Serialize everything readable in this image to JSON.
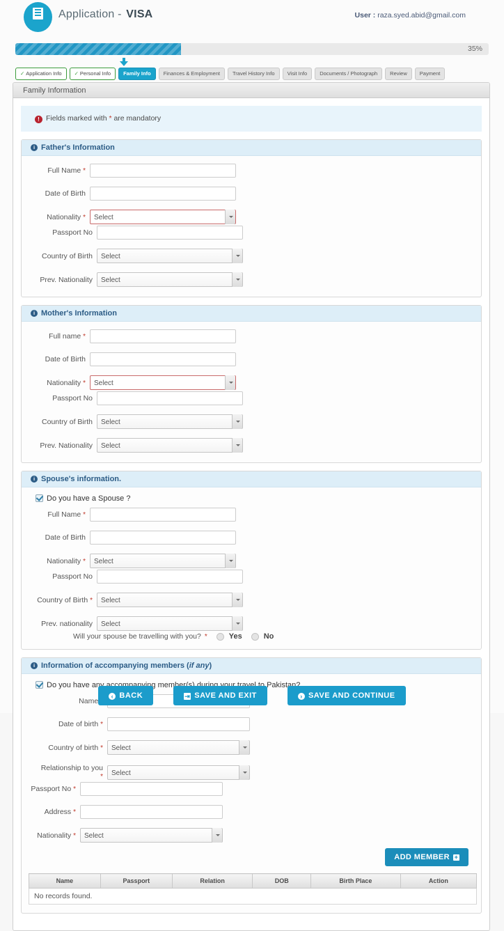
{
  "header": {
    "logo_icon": "document-list-icon",
    "app_title": "Application - ",
    "app_title_bold": "VISA",
    "user_label": "User : ",
    "user_email": "raza.syed.abid@gmail.com"
  },
  "progress": {
    "percent_label": "35%",
    "percent_value": 35,
    "fill_color": "#2196c4",
    "track_color": "#e9e9e9"
  },
  "tabs": [
    {
      "label": "Application Info",
      "state": "done",
      "check": "✓"
    },
    {
      "label": "Personal Info",
      "state": "done",
      "check": "✓"
    },
    {
      "label": "Family Info",
      "state": "active"
    },
    {
      "label": "Finances & Employment",
      "state": "pending"
    },
    {
      "label": "Travel History Info",
      "state": "pending"
    },
    {
      "label": "Visit Info",
      "state": "pending"
    },
    {
      "label": "Documents / Photograph",
      "state": "pending"
    },
    {
      "label": "Review",
      "state": "pending"
    },
    {
      "label": "Payment",
      "state": "pending"
    }
  ],
  "panel": {
    "title": "Family Information"
  },
  "notice": {
    "icon": "exclamation-icon",
    "text_before": "Fields marked with ",
    "star": "*",
    "text_after": " are mandatory"
  },
  "father": {
    "heading": "Father's Information",
    "full_name_label": "Full Name",
    "full_name_value": "",
    "dob_label": "Date of Birth",
    "dob_value": "",
    "nationality_label": "Nationality",
    "nationality_value": "Select",
    "passport_label": "Passport No",
    "passport_value": "",
    "country_label": "Country of Birth",
    "country_value": "Select",
    "prev_nat_label": "Prev. Nationality",
    "prev_nat_value": "Select"
  },
  "mother": {
    "heading": "Mother's Information",
    "full_name_label": "Full name",
    "full_name_value": "",
    "dob_label": "Date of Birth",
    "dob_value": "",
    "nationality_label": "Nationality",
    "nationality_value": "Select",
    "passport_label": "Passport No",
    "passport_value": "",
    "country_label": "Country of Birth",
    "country_value": "Select",
    "prev_nat_label": "Prev. Nationality",
    "prev_nat_value": "Select"
  },
  "spouse": {
    "heading": "Spouse's information.",
    "checkbox_label": "Do you have a Spouse ?",
    "checkbox_checked": true,
    "full_name_label": "Full Name",
    "full_name_value": "",
    "dob_label": "Date of Birth",
    "dob_value": "",
    "nationality_label": "Nationality",
    "nationality_value": "Select",
    "passport_label": "Passport No",
    "passport_value": "",
    "country_label": "Country of Birth",
    "country_value": "Select",
    "prev_nat_label": "Prev. nationality",
    "prev_nat_value": "Select",
    "travel_question": "Will your spouse be travelling with you?",
    "yes_label": "Yes",
    "no_label": "No",
    "selected": ""
  },
  "accompanying": {
    "heading_before": "Information of accompanying members (",
    "heading_italic": "if any",
    "heading_after": ")",
    "checkbox_label": "Do you have any accompanying member(s) during your travel to Pakistan?",
    "checkbox_checked": true,
    "name_label": "Name",
    "name_value": "",
    "dob_label": "Date of birth",
    "dob_value": "",
    "country_label": "Country of birth",
    "country_value": "Select",
    "relationship_label": "Relationship to you",
    "relationship_value": "Select",
    "passport_label": "Passport No",
    "passport_value": "",
    "address_label": "Address",
    "address_value": "",
    "nationality_label": "Nationality",
    "nationality_value": "Select",
    "add_member_label": "ADD MEMBER",
    "add_icon": "plus-icon",
    "table": {
      "columns": [
        "Name",
        "Passport",
        "Relation",
        "DOB",
        "Birth Place",
        "Action"
      ],
      "rows": [],
      "empty_message": "No records found."
    }
  },
  "footer": {
    "back_label": "BACK",
    "back_icon": "circle-left-icon",
    "save_exit_label": "SAVE AND EXIT",
    "save_exit_icon": "exit-icon",
    "save_continue_label": "SAVE AND CONTINUE",
    "save_continue_icon": "circle-right-icon"
  },
  "colors": {
    "accent": "#1ba4cc",
    "section_header_bg": "#ddeef8",
    "section_header_text": "#2c5c86",
    "required_star": "#c0392b",
    "done_tab_border": "#3c9c3c"
  }
}
